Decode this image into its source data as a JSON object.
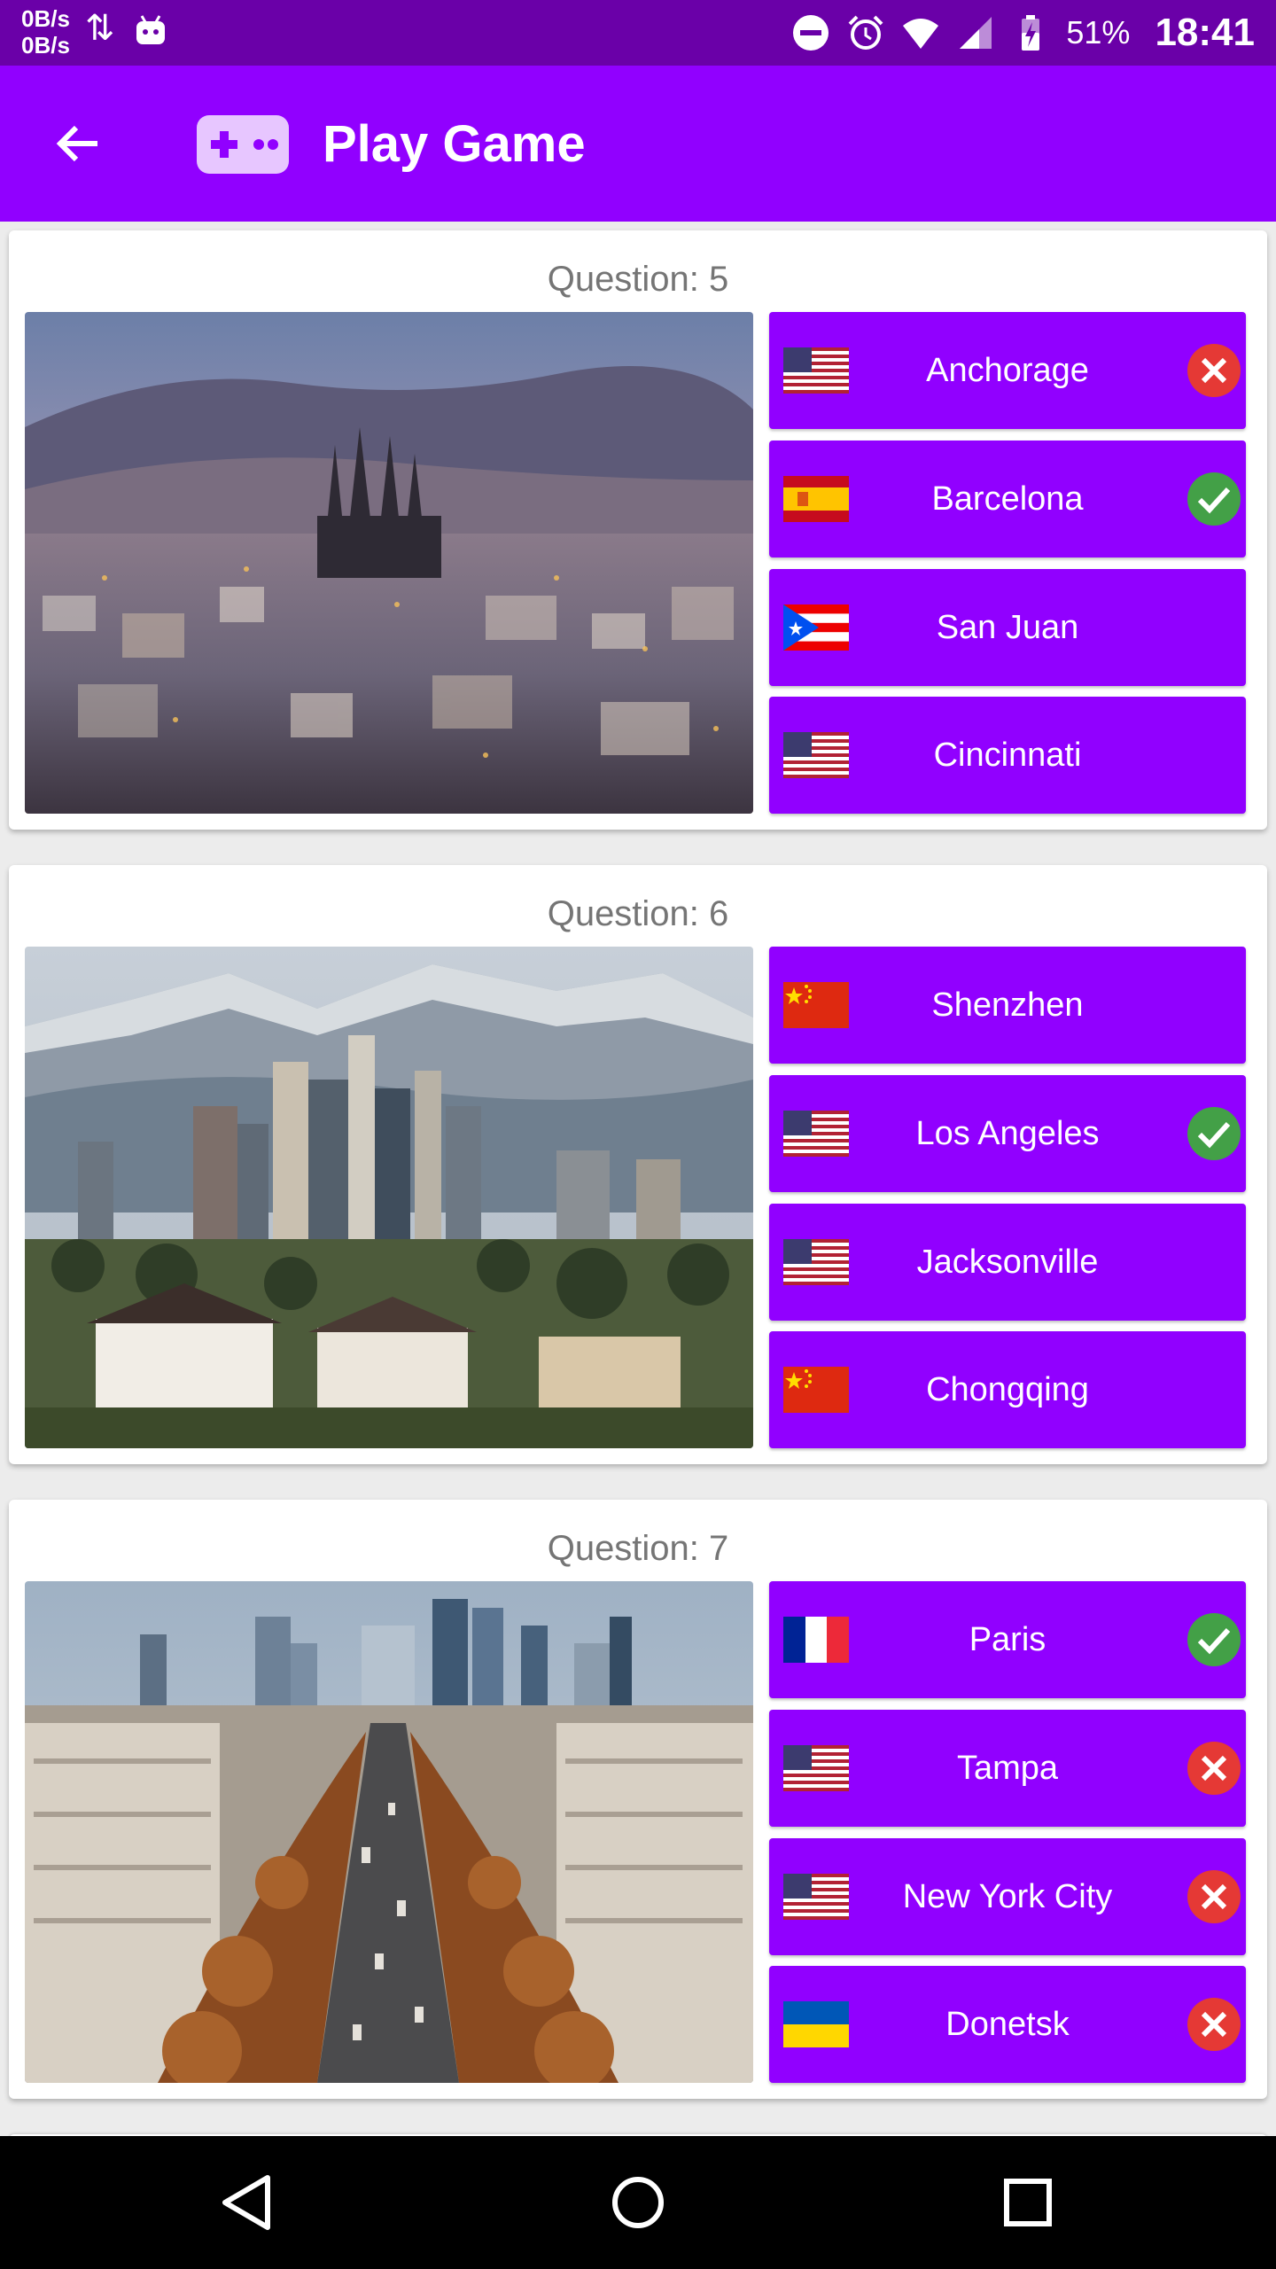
{
  "status_bar": {
    "net_up": "0B/s",
    "net_down": "0B/s",
    "battery": "51%",
    "time": "18:41"
  },
  "app_bar": {
    "title": "Play Game",
    "color": "#9100ff"
  },
  "questions": [
    {
      "title": "Question: 5",
      "photo": "barcelona-cityscape",
      "answers": [
        {
          "label": "Anchorage",
          "flag": "us",
          "mark": "wrong"
        },
        {
          "label": "Barcelona",
          "flag": "es",
          "mark": "correct"
        },
        {
          "label": "San Juan",
          "flag": "pr",
          "mark": "none"
        },
        {
          "label": "Cincinnati",
          "flag": "us",
          "mark": "none"
        }
      ]
    },
    {
      "title": "Question: 6",
      "photo": "los-angeles-skyline",
      "answers": [
        {
          "label": "Shenzhen",
          "flag": "cn",
          "mark": "none"
        },
        {
          "label": "Los Angeles",
          "flag": "us",
          "mark": "correct"
        },
        {
          "label": "Jacksonville",
          "flag": "us",
          "mark": "none"
        },
        {
          "label": "Chongqing",
          "flag": "cn",
          "mark": "none"
        }
      ]
    },
    {
      "title": "Question: 7",
      "photo": "paris-avenue",
      "answers": [
        {
          "label": "Paris",
          "flag": "fr",
          "mark": "correct"
        },
        {
          "label": "Tampa",
          "flag": "us",
          "mark": "wrong"
        },
        {
          "label": "New York City",
          "flag": "us",
          "mark": "wrong"
        },
        {
          "label": "Donetsk",
          "flag": "ua",
          "mark": "wrong"
        }
      ]
    }
  ],
  "colors": {
    "correct": "#43a047",
    "wrong": "#e53935",
    "status_bar": "#6a00a8"
  }
}
